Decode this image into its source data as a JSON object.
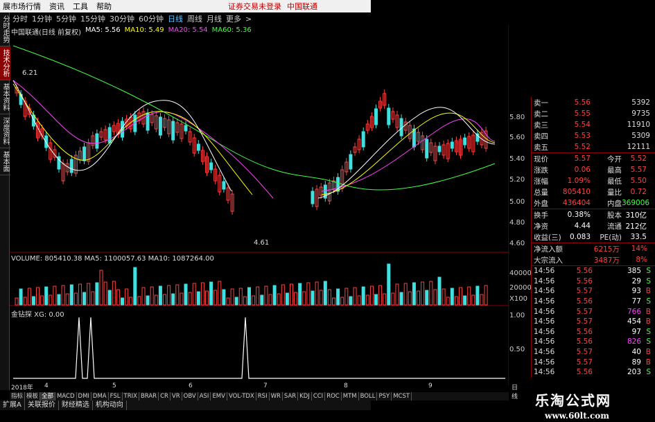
{
  "menu": {
    "items": [
      "展市场行情",
      "资讯",
      "工具",
      "帮助"
    ],
    "links": [
      "证券交易未登录",
      "中国联通"
    ]
  },
  "timeframes": {
    "items": [
      "分时",
      "1分钟",
      "5分钟",
      "15分钟",
      "30分钟",
      "60分钟",
      "日线",
      "周线",
      "月线",
      "更多"
    ],
    "selected": "日线",
    "more_arrow": ">"
  },
  "left_tabs": [
    "分时走势",
    "技术分析",
    "基本资料",
    "深度资料",
    "基本面"
  ],
  "ma_info": {
    "title": "中国联通(日线 前复权)",
    "ma5": "MA5: 5.56",
    "ma10": "MA10: 5.49",
    "ma20": "MA20: 5.54",
    "ma60": "MA60: 5.36"
  },
  "chart": {
    "price_high_label": "6.21",
    "price_low_label": "4.61",
    "price_axis": [
      "5.80",
      "5.60",
      "5.40",
      "5.20",
      "5.00",
      "4.80",
      "4.60"
    ],
    "vol_axis": [
      "40000",
      "20000",
      "X100"
    ],
    "xg_axis": [
      "1.00",
      "0.50"
    ]
  },
  "volume_info": "VOLUME: 805410.38  MA5: 1100057.63  MA10: 1087264.00",
  "xg_info": "金钻探 XG: 0.00",
  "date_axis": [
    "2018年",
    "4",
    "5",
    "6",
    "7",
    "8",
    "9"
  ],
  "date_axis_end": "日线",
  "quote": {
    "bids": [
      {
        "label": "卖一",
        "price": "5.56",
        "vol": "5392"
      },
      {
        "label": "卖二",
        "price": "5.55",
        "vol": "9735"
      },
      {
        "label": "卖三",
        "price": "5.54",
        "vol": "11910"
      },
      {
        "label": "卖四",
        "price": "5.53",
        "vol": "5309"
      },
      {
        "label": "卖五",
        "price": "5.52",
        "vol": "12111"
      }
    ],
    "stats": [
      {
        "l": "现价",
        "v": "5.57",
        "r": "今开",
        "v2": "5.52"
      },
      {
        "l": "涨跌",
        "v": "0.06",
        "r": "最高",
        "v2": "5.57"
      },
      {
        "l": "涨幅",
        "v": "1.09%",
        "r": "最低",
        "v2": "5.50"
      },
      {
        "l": "总量",
        "v": "805410",
        "r": "量比",
        "v2": "0.72"
      },
      {
        "l": "外盘",
        "v": "436404",
        "r": "内盘",
        "v2": "369006"
      }
    ],
    "stats2": [
      {
        "l": "换手",
        "v": "0.38%",
        "r": "股本",
        "v2": "310亿"
      },
      {
        "l": "净资",
        "v": "4.44",
        "r": "流通",
        "v2": "212亿"
      },
      {
        "l": "收益(三)",
        "v": "0.083",
        "r": "PE(动)",
        "v2": "33.5"
      }
    ],
    "flow": [
      {
        "l": "净流入额",
        "v": "6215万",
        "v2": "14%"
      },
      {
        "l": "大宗流入",
        "v": "3487万",
        "v2": "8%"
      }
    ],
    "ticks": [
      {
        "t": "14:56",
        "p": "5.56",
        "v": "385",
        "s": "S"
      },
      {
        "t": "14:56",
        "p": "5.56",
        "v": "29",
        "s": "S"
      },
      {
        "t": "14:56",
        "p": "5.57",
        "v": "93",
        "s": "B"
      },
      {
        "t": "14:56",
        "p": "5.56",
        "v": "77",
        "s": "S"
      },
      {
        "t": "14:56",
        "p": "5.57",
        "v": "766",
        "s": "B"
      },
      {
        "t": "14:56",
        "p": "5.57",
        "v": "454",
        "s": "B"
      },
      {
        "t": "14:56",
        "p": "5.56",
        "v": "97",
        "s": "S"
      },
      {
        "t": "14:56",
        "p": "5.56",
        "v": "826",
        "s": "S"
      },
      {
        "t": "14:56",
        "p": "5.57",
        "v": "40",
        "s": "B"
      },
      {
        "t": "14:56",
        "p": "5.57",
        "v": "89",
        "s": "B"
      },
      {
        "t": "14:56",
        "p": "5.56",
        "v": "203",
        "s": "S"
      }
    ]
  },
  "indicators": [
    "指标",
    "模板",
    "全部",
    "MACD",
    "DMI",
    "DMA",
    "FSL",
    "TRIX",
    "BRAR",
    "CR",
    "VR",
    "OBV",
    "ASI",
    "EMV",
    "VOL-TDX",
    "RSI",
    "WR",
    "SAR",
    "KDJ",
    "CCI",
    "ROC",
    "MTM",
    "BOLL",
    "PSY",
    "MCST"
  ],
  "bottom_tabs": [
    "扩展A",
    "关联报价",
    "财经精选",
    "机构动向"
  ],
  "brand": {
    "name": "乐淘公式网",
    "url": "www.60lt.com"
  },
  "colors": {
    "up": "#ff4040",
    "down": "#40e0e0",
    "ma5": "#ffffff",
    "ma10": "#ffff00",
    "ma20": "#ff40ff",
    "ma60": "#40ff40"
  }
}
